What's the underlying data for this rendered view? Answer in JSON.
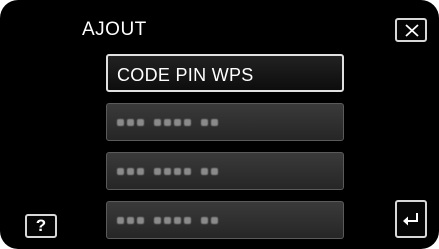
{
  "header": {
    "title": "AJOUT"
  },
  "menu": {
    "items": [
      {
        "label": "CODE PIN WPS",
        "type": "text"
      },
      {
        "label": "",
        "type": "blurred-pin"
      },
      {
        "label": "",
        "type": "blurred-pin"
      },
      {
        "label": "",
        "type": "blurred-pin"
      }
    ]
  },
  "help": {
    "label": "?"
  },
  "icons": {
    "close": "close-icon",
    "back": "back-arrow-icon",
    "help": "question-mark-icon"
  },
  "colors": {
    "background": "#000000",
    "text": "#ffffff",
    "button_border": "#d8d8d8"
  }
}
